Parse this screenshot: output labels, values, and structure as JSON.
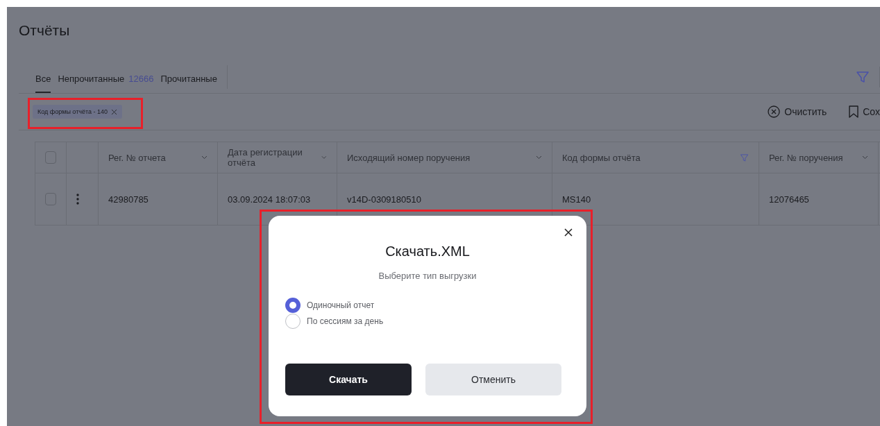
{
  "page": {
    "title": "Отчёты"
  },
  "tabs": [
    {
      "label": "Все",
      "selected": true
    },
    {
      "label": "Непрочитанные",
      "count": "12666",
      "selected": false
    },
    {
      "label": "Прочитанные",
      "selected": false
    }
  ],
  "filter_chips": [
    {
      "label": "Код формы отчёта - 140"
    }
  ],
  "actions": [
    {
      "kind": "clear",
      "label": "Очистить"
    },
    {
      "kind": "save",
      "label": "Сох"
    }
  ],
  "table": {
    "header_checked": false,
    "columns": [
      {
        "label": "Рег. № отчета",
        "kind": "sort"
      },
      {
        "label": "Дата регистрации отчёта",
        "kind": "sort"
      },
      {
        "label": "Исходящий номер поручения",
        "kind": "sort"
      },
      {
        "label": "Код формы отчёта",
        "kind": "filter"
      },
      {
        "label": "Рег. № поручения",
        "kind": "sort"
      }
    ],
    "rows": [
      {
        "checked": false,
        "cells": [
          "42980785",
          "03.09.2024 18:07:03",
          "v14D-0309180510",
          "MS140",
          "12076465"
        ]
      }
    ]
  },
  "dialog": {
    "title": "Скачать.XML",
    "subtitle": "Выберите тип выгрузки",
    "options": [
      {
        "label": "Одиночный отчет",
        "selected": true
      },
      {
        "label": "По сессиям за день",
        "selected": false
      }
    ],
    "buttons": [
      {
        "label": "Скачать",
        "kind": "primary"
      },
      {
        "label": "Отменить",
        "kind": "secondary"
      }
    ]
  }
}
